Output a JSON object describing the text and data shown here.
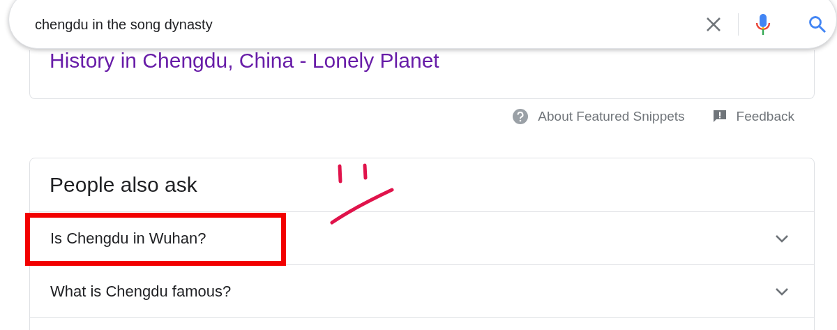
{
  "search": {
    "value": "chengdu in the song dynasty"
  },
  "result": {
    "title": "History in Chengdu, China - Lonely Planet"
  },
  "snippet_footer": {
    "about": "About Featured Snippets",
    "feedback": "Feedback"
  },
  "people_also_ask": {
    "title": "People also ask",
    "questions": [
      {
        "text": "Is Chengdu in Wuhan?",
        "expanded": false
      },
      {
        "text": "What is Chengdu famous?",
        "expanded": false
      }
    ]
  }
}
